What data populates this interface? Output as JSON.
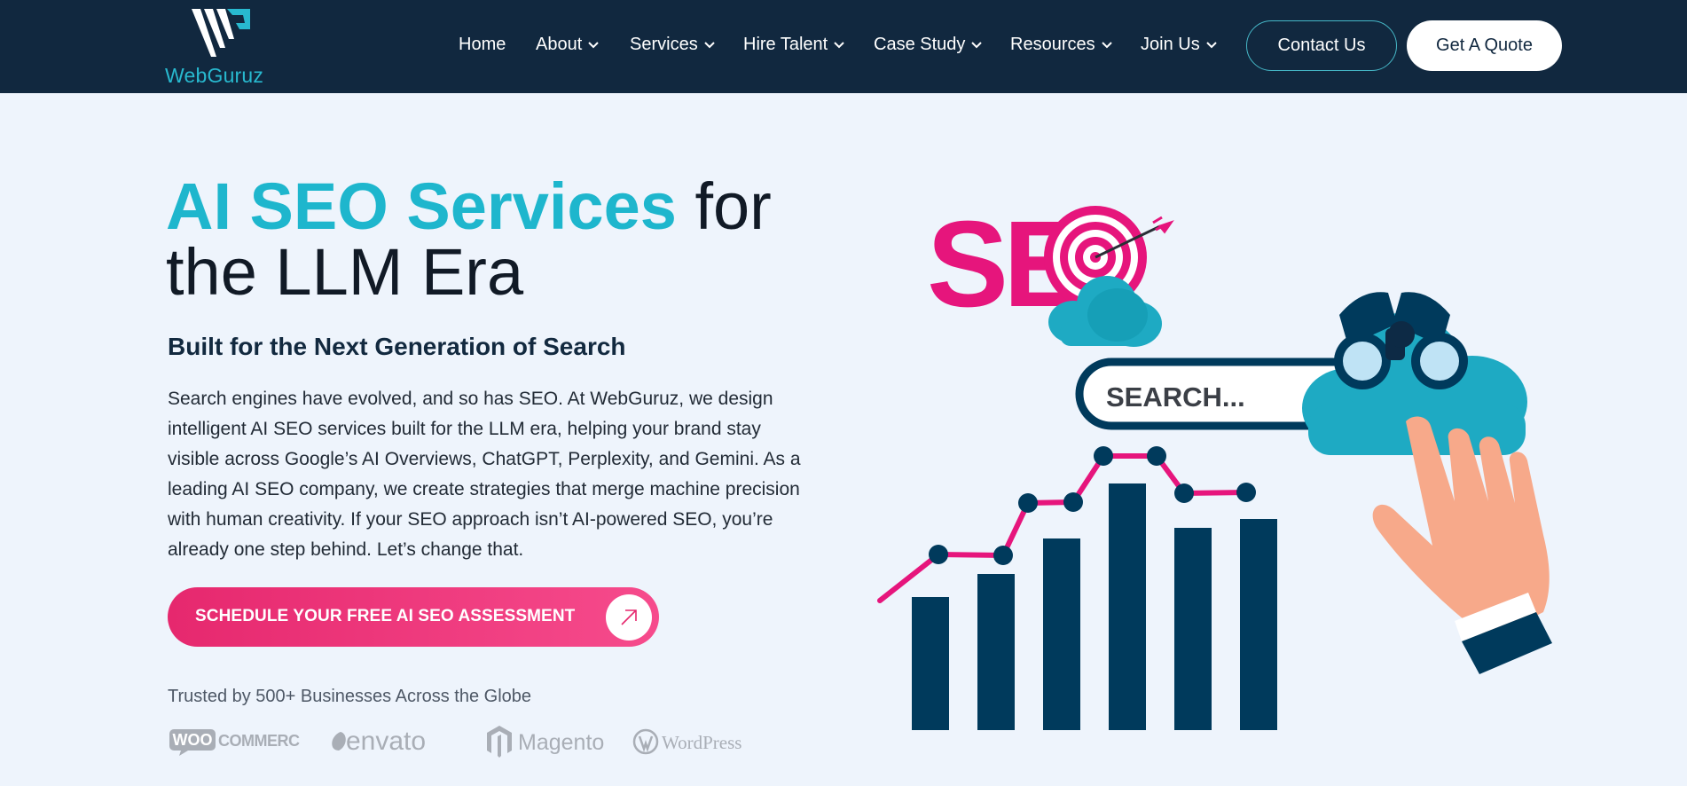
{
  "header": {
    "logo_text": "WebGuruz",
    "nav": [
      {
        "label": "Home",
        "has_dropdown": false
      },
      {
        "label": "About",
        "has_dropdown": true
      },
      {
        "label": "Services",
        "has_dropdown": true
      },
      {
        "label": "Hire Talent",
        "has_dropdown": true
      },
      {
        "label": "Case Study",
        "has_dropdown": true
      },
      {
        "label": "Resources",
        "has_dropdown": true
      },
      {
        "label": "Join Us",
        "has_dropdown": true
      }
    ],
    "contact_label": "Contact Us",
    "quote_label": "Get A Quote"
  },
  "hero": {
    "title_accent": "AI SEO Services",
    "title_rest_1": " for",
    "title_rest_2": "the LLM Era",
    "subtitle": "Built for the Next Generation of Search",
    "paragraph": "Search engines have evolved, and so has SEO. At WebGuruz, we design intelligent AI SEO services built for the LLM era, helping your brand stay visible across Google’s AI Overviews, ChatGPT, Perplexity, and Gemini. As a leading AI SEO company, we create strategies that merge machine precision with human creativity. If your SEO approach isn’t AI-powered SEO, you’re already one step behind. Let’s change that.",
    "cta_label": "SCHEDULE YOUR FREE AI SEO ASSESSMENT",
    "trusted_text": "Trusted by 500+ Businesses Across the Globe",
    "brands": [
      "WOO",
      "COMMERCE",
      "envato",
      "Magento",
      "WordPress"
    ]
  },
  "illustration": {
    "seo_text": "SE",
    "search_text": "SEARCH...",
    "colors": {
      "navy": "#003a5c",
      "pink": "#e6157c",
      "cyan": "#1fb6cf",
      "skin": "#f7a98a"
    }
  },
  "colors": {
    "nav_bg": "#11283f",
    "accent": "#1eb6cd",
    "cta": "#ee3b80",
    "page_bg": "#eef4fc"
  }
}
